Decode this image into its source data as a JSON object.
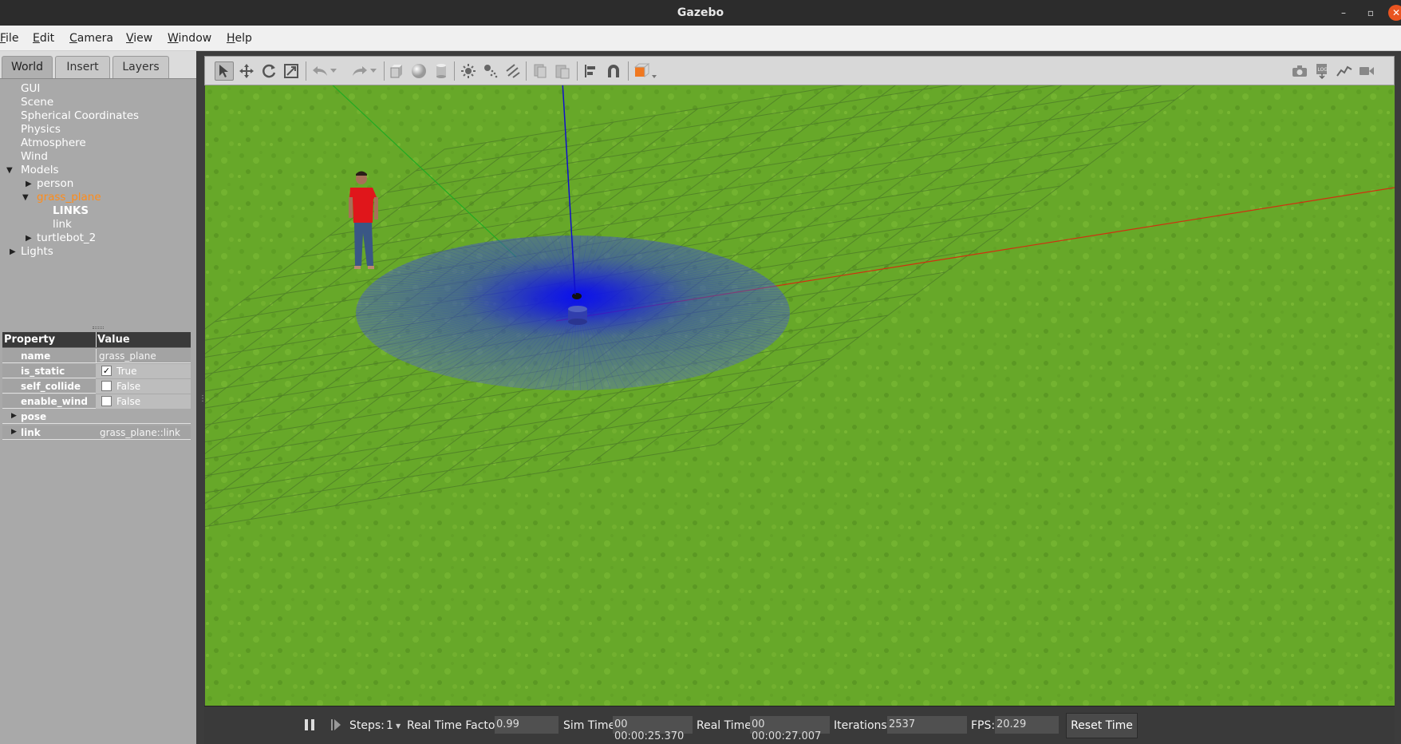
{
  "window": {
    "title": "Gazebo"
  },
  "menu": {
    "file": "File",
    "edit": "Edit",
    "camera": "Camera",
    "view": "View",
    "window": "Window",
    "help": "Help"
  },
  "tabs": {
    "world": "World",
    "insert": "Insert",
    "layers": "Layers"
  },
  "tree": {
    "gui": "GUI",
    "scene": "Scene",
    "spherical": "Spherical Coordinates",
    "physics": "Physics",
    "atmosphere": "Atmosphere",
    "wind": "Wind",
    "models": "Models",
    "person": "person",
    "grass_plane": "grass_plane",
    "links": "LINKS",
    "link": "link",
    "turtlebot": "turtlebot_2",
    "lights": "Lights"
  },
  "properties": {
    "header_property": "Property",
    "header_value": "Value",
    "rows": [
      {
        "key": "name",
        "value": "grass_plane"
      },
      {
        "key": "is_static",
        "value": "True",
        "checked": true
      },
      {
        "key": "self_collide",
        "value": "False",
        "checked": false
      },
      {
        "key": "enable_wind",
        "value": "False",
        "checked": false
      },
      {
        "key": "pose",
        "value": ""
      },
      {
        "key": "link",
        "value": "grass_plane::link"
      }
    ]
  },
  "bottom": {
    "steps_label": "Steps:",
    "steps_value": "1",
    "rtf_label": "Real Time Factor:",
    "rtf_value": "0.99",
    "sim_label": "Sim Time:",
    "sim_value": "00 00:00:25.370",
    "real_label": "Real Time:",
    "real_value": "00 00:00:27.007",
    "iter_label": "Iterations:",
    "iter_value": "2537",
    "fps_label": "FPS:",
    "fps_value": "20.29",
    "reset_label": "Reset Time"
  },
  "colors": {
    "grass": "#6fae2a",
    "selection": "#ff8c1a",
    "laser": "#1a1aff",
    "axis_x": "#d03010",
    "axis_y": "#22aa22",
    "axis_z": "#1010cc"
  }
}
